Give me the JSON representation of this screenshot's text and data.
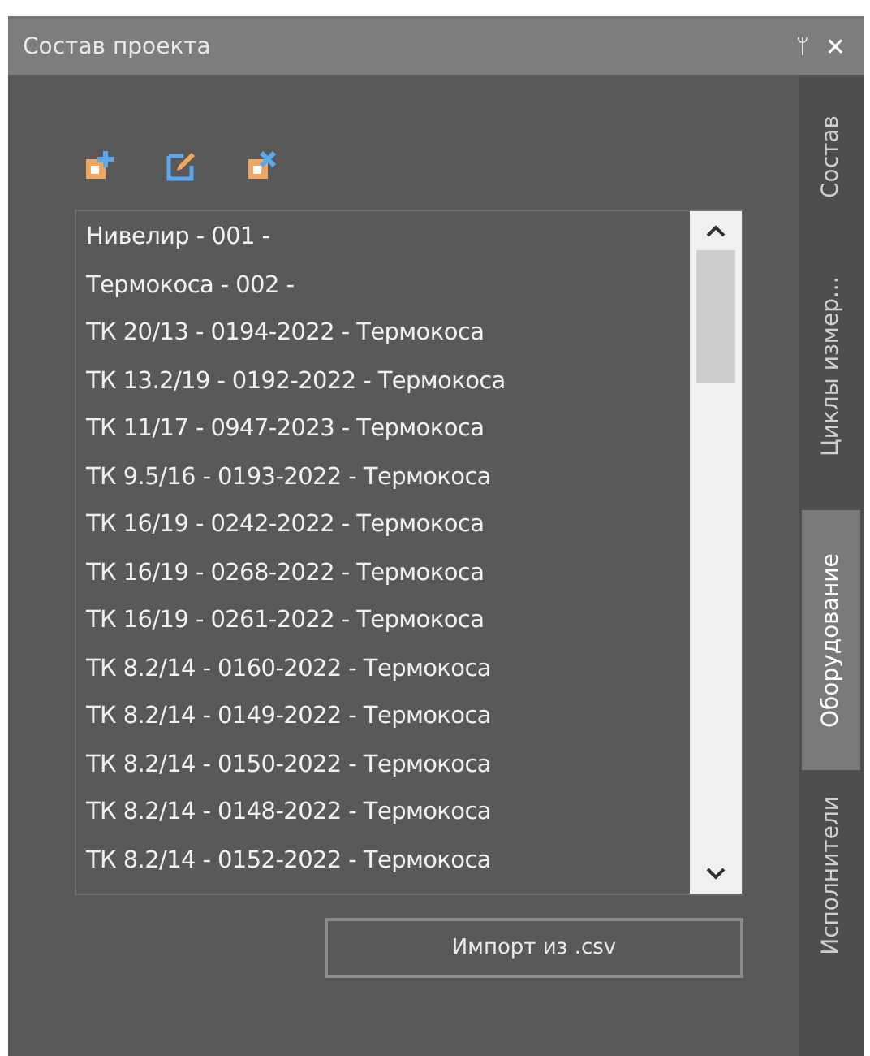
{
  "window": {
    "title": "Состав проекта",
    "pin": "ᛘ",
    "close": "✕"
  },
  "toolbar": [
    {
      "kind": "add"
    },
    {
      "kind": "edit"
    },
    {
      "kind": "remove"
    }
  ],
  "list": {
    "items": [
      {
        "label": "Нивелир - 001 -"
      },
      {
        "label": "Термокоса - 002 -"
      },
      {
        "label": "ТК 20/13 - 0194-2022 - Термокоса"
      },
      {
        "label": "ТК 13.2/19 - 0192-2022 - Термокоса"
      },
      {
        "label": "ТК 11/17 - 0947-2023 - Термокоса"
      },
      {
        "label": "ТК 9.5/16 - 0193-2022 - Термокоса"
      },
      {
        "label": "ТК 16/19 - 0242-2022 - Термокоса"
      },
      {
        "label": "ТК 16/19 - 0268-2022 - Термокоса"
      },
      {
        "label": "ТК 16/19 - 0261-2022 - Термокоса"
      },
      {
        "label": "ТК 8.2/14 - 0160-2022 - Термокоса"
      },
      {
        "label": "ТК 8.2/14 - 0149-2022 - Термокоса"
      },
      {
        "label": "ТК 8.2/14 - 0150-2022 - Термокоса"
      },
      {
        "label": "ТК 8.2/14 - 0148-2022 - Термокоса"
      },
      {
        "label": "ТК 8.2/14 - 0152-2022 - Термокоса"
      }
    ]
  },
  "import_button": "Импорт из .csv",
  "side_tabs": [
    {
      "label": "Состав",
      "selected": false
    },
    {
      "label": "Циклы измер...",
      "selected": false
    },
    {
      "label": "Оборудование",
      "selected": true
    },
    {
      "label": "Исполнители",
      "selected": false
    }
  ]
}
